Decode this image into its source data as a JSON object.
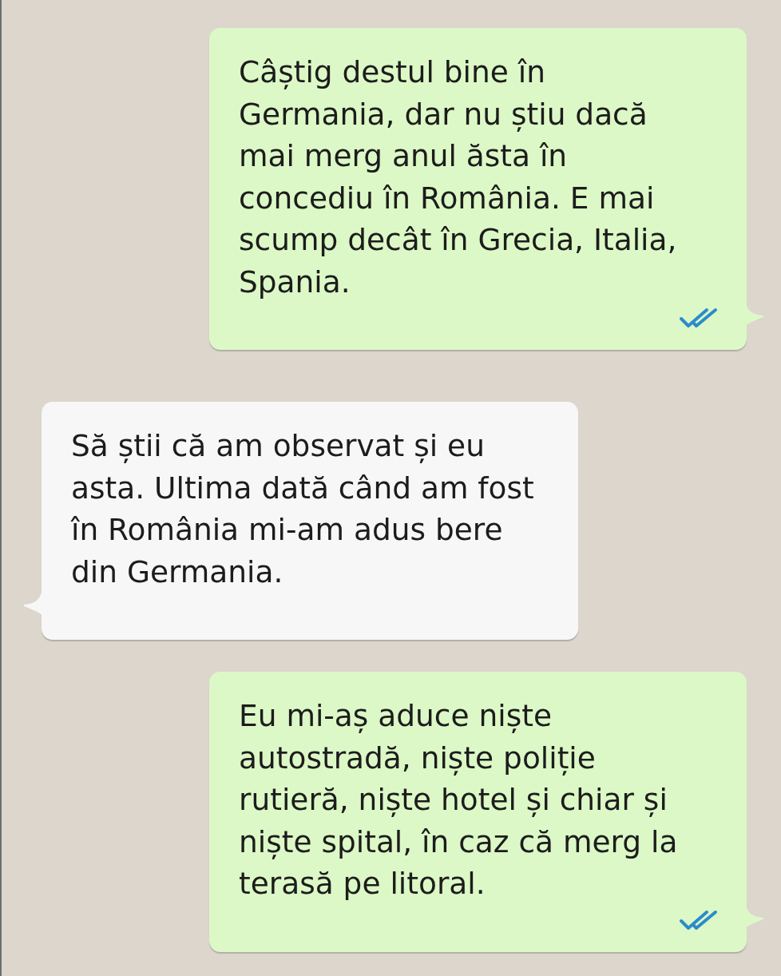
{
  "messages": [
    {
      "kind": "outgoing",
      "text": "Câștig destul bine în\nGermania, dar nu știu dacă\nmai merg anul ăsta în\nconcediu în România. E mai\nscump decât în Grecia, Italia,\nSpania.",
      "read": true
    },
    {
      "kind": "incoming",
      "text": "Să știi că am observat și eu\nasta. Ultima dată când am fost\nîn România mi-am adus bere\ndin Germania."
    },
    {
      "kind": "outgoing",
      "text": "Eu mi-aș aduce niște\nautostradă, niște poliție\nrutieră, niște hotel și chiar și\nniște spital, în caz că merg la\nterasă pe litoral.",
      "read": true
    }
  ]
}
